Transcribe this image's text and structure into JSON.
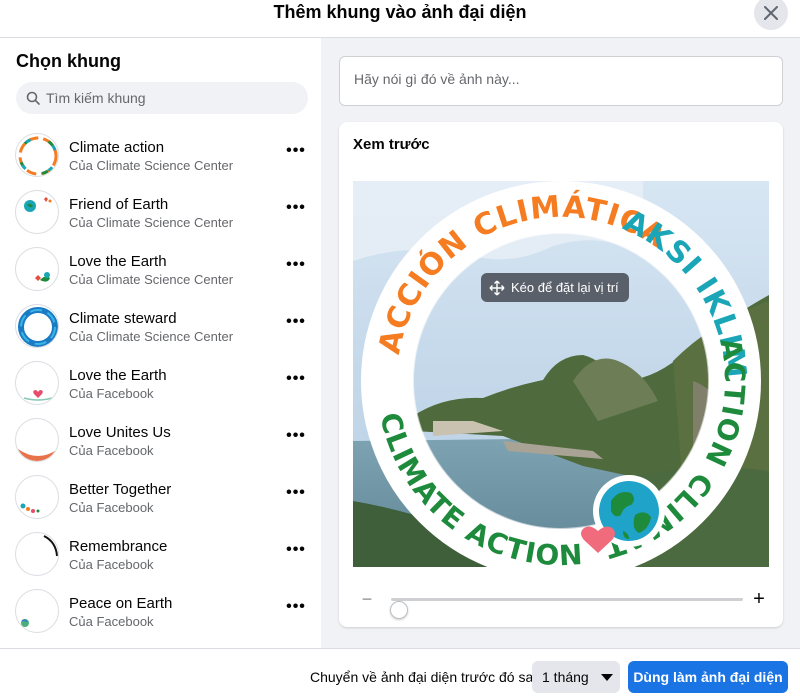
{
  "dialog": {
    "title": "Thêm khung vào ảnh đại diện",
    "close_icon": "close-icon"
  },
  "sidebar": {
    "title": "Chọn khung",
    "search_placeholder": "Tìm kiếm khung",
    "frames": [
      {
        "name": "Climate action",
        "owner": "Của Climate Science Center"
      },
      {
        "name": "Friend of Earth",
        "owner": "Của Climate Science Center"
      },
      {
        "name": "Love the Earth",
        "owner": "Của Climate Science Center"
      },
      {
        "name": "Climate steward",
        "owner": "Của Climate Science Center"
      },
      {
        "name": "Love the Earth",
        "owner": "Của Facebook"
      },
      {
        "name": "Love Unites Us",
        "owner": "Của Facebook"
      },
      {
        "name": "Better Together",
        "owner": "Của Facebook"
      },
      {
        "name": "Remembrance",
        "owner": "Của Facebook"
      },
      {
        "name": "Peace on Earth",
        "owner": "Của Facebook"
      }
    ],
    "more_label": "•••"
  },
  "main": {
    "caption_placeholder": "Hãy nói gì đó về ảnh này...",
    "preview_label": "Xem trước",
    "reposition_label": "Kéo để đặt lại vị trí",
    "frame_text": {
      "top_left": "ACCIÓN CLIMÁTICA",
      "top_right": "AKSI IKLIM",
      "right": "ACTION CLIMAT",
      "bottom": "CLIMATE ACTION"
    },
    "zoom_minus": "−",
    "zoom_plus": "+",
    "zoom_level": 0
  },
  "footer": {
    "revert_label": "Chuyển về ảnh đại diện trước đó sau",
    "duration_value": "1 tháng",
    "primary_button": "Dùng làm ảnh đại diện"
  },
  "colors": {
    "primary": "#1b74e4",
    "orange": "#f57c20",
    "teal": "#1aa6b7",
    "green": "#1e8a3c",
    "panel_bg": "#f0f2f5"
  }
}
